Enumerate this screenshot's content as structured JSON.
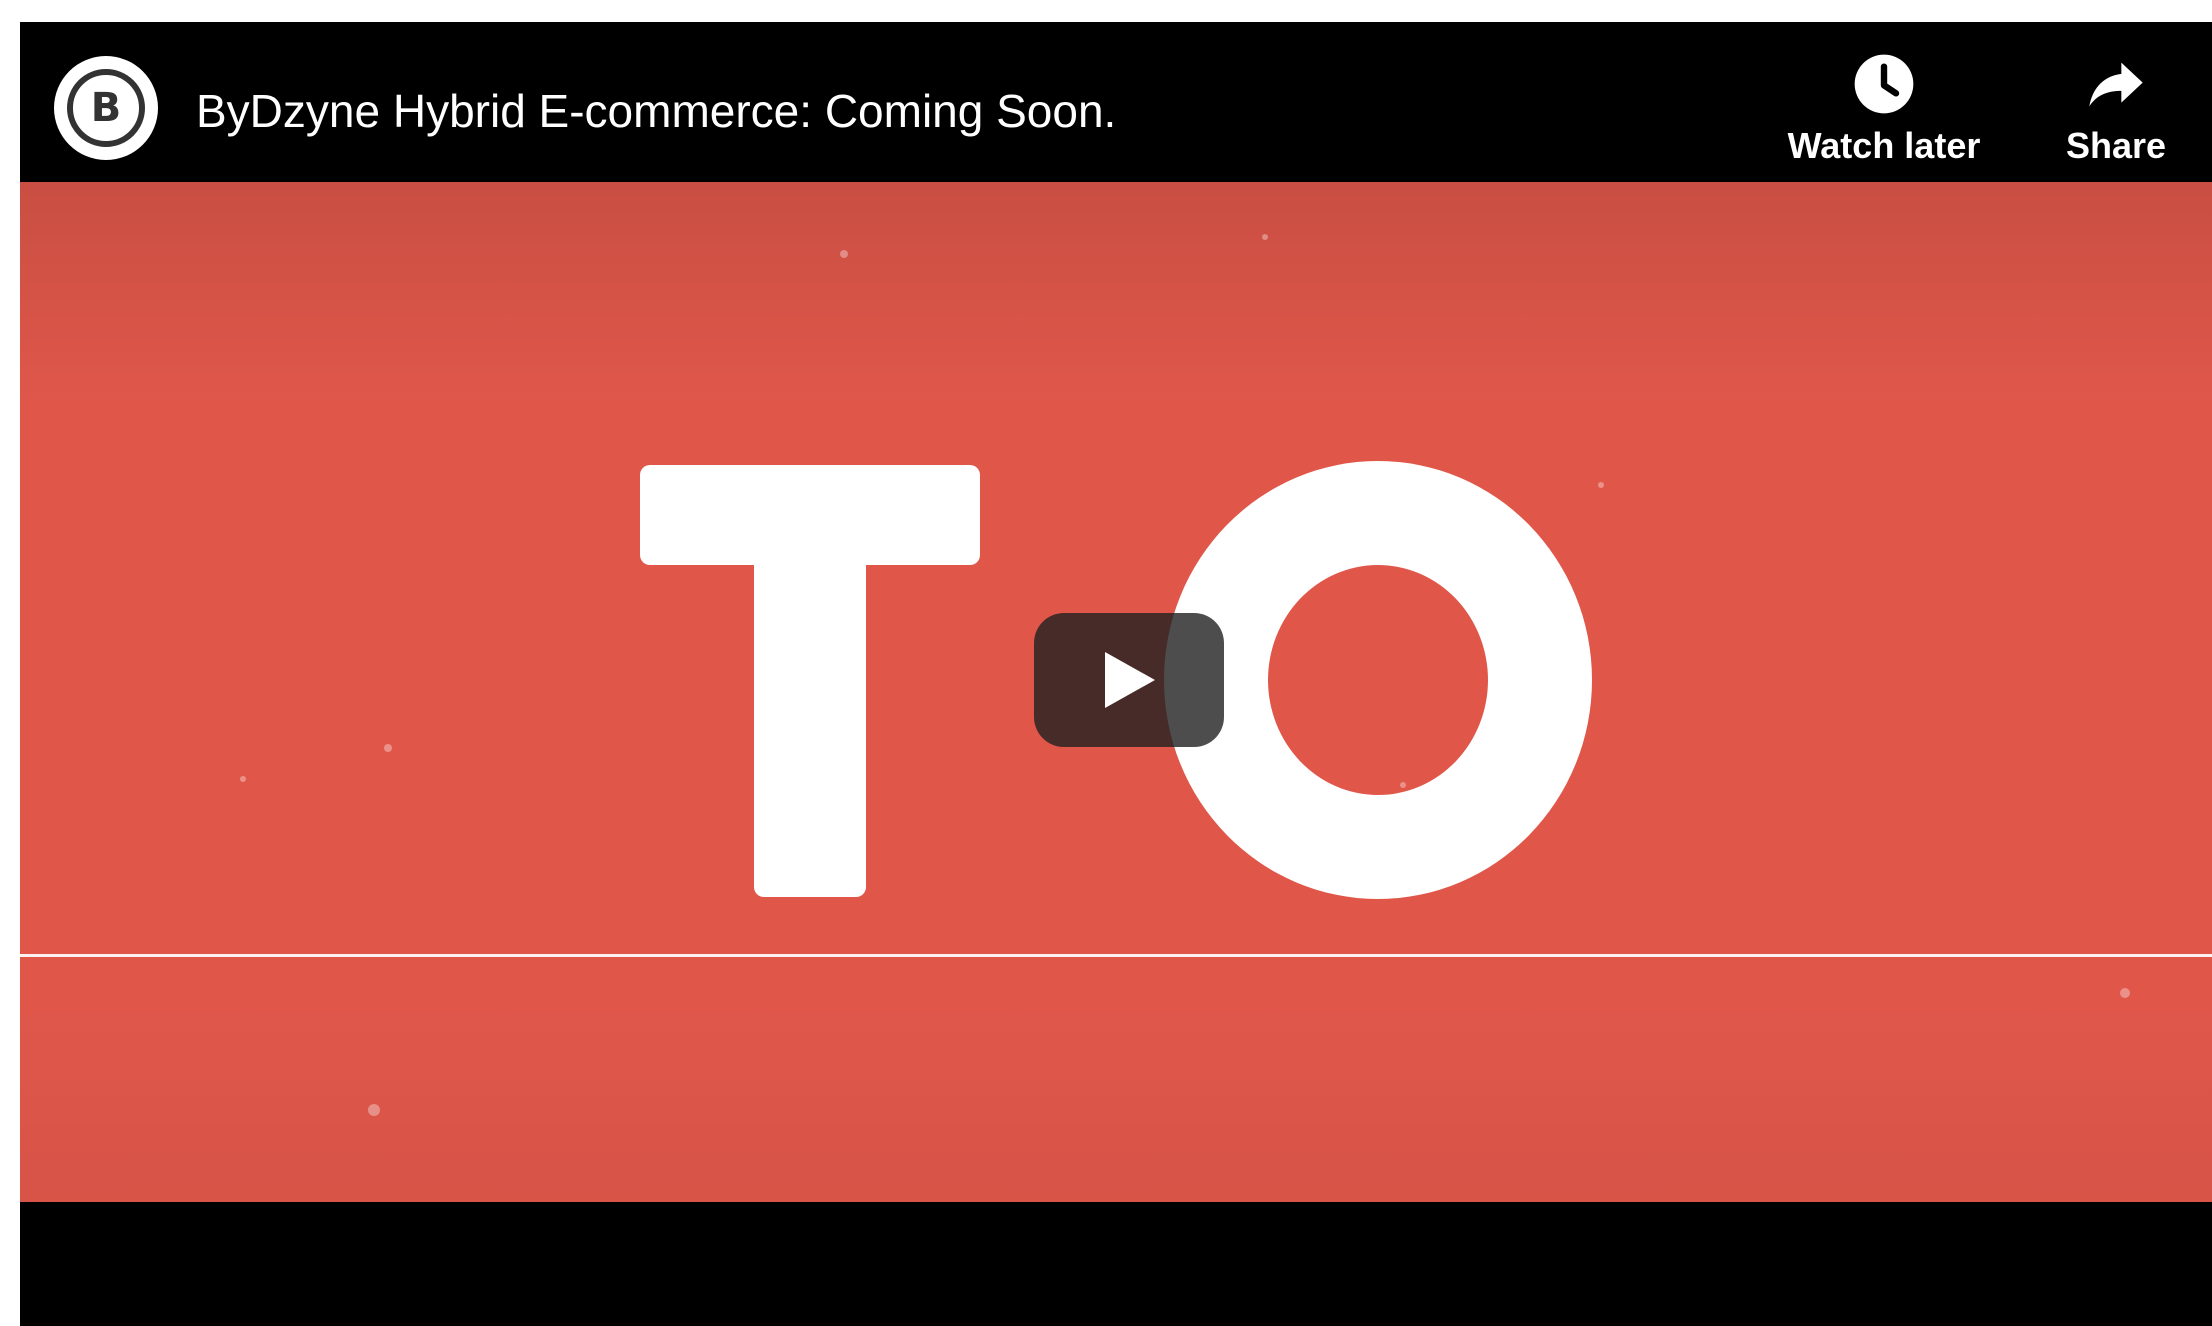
{
  "header": {
    "title": "ByDzyne Hybrid E-commerce: Coming Soon.",
    "avatar_letter": "B"
  },
  "actions": {
    "watch_later": {
      "label": "Watch later",
      "icon": "clock-icon"
    },
    "share": {
      "label": "Share",
      "icon": "share-arrow-icon"
    }
  },
  "player": {
    "play_icon": "play-icon",
    "frame_text": "TO"
  },
  "colors": {
    "frame_background": "#e0574a",
    "player_background": "#000000",
    "text": "#ffffff"
  }
}
